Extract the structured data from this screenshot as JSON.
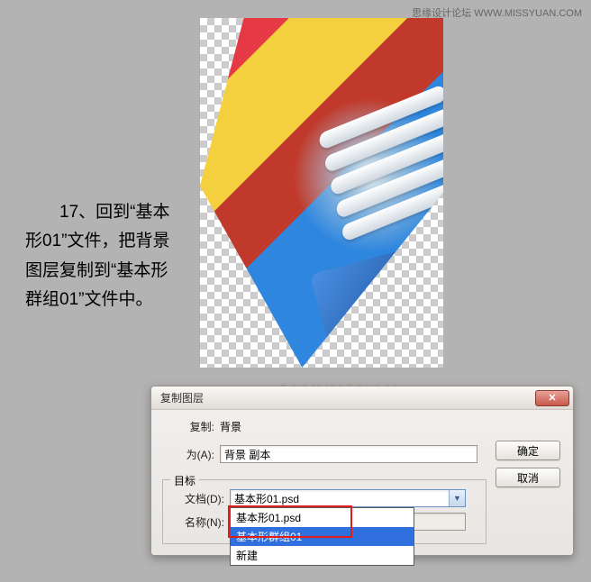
{
  "top_watermark": "思缘设计论坛  WWW.MISSYUAN.COM",
  "instruction": "　　17、回到“基本形01”文件，把背景图层复制到“基本形群组01”文件中。",
  "watermark_brand": "JANNYCHAN",
  "watermark_url": "HTTP://JANNYSTORY.POCO.CN",
  "dialog": {
    "title": "复制图层",
    "copy_label": "复制:",
    "copy_value": "背景",
    "as_label": "为(A):",
    "as_value": "背景 副本",
    "target_legend": "目标",
    "doc_label": "文档(D):",
    "doc_value": "基本形01.psd",
    "name_label": "名称(N):",
    "name_value": "",
    "dropdown": {
      "options": [
        "基本形01.psd",
        "基本形群组01",
        "新建"
      ],
      "selected_index": 1
    },
    "ok": "确定",
    "cancel": "取消"
  }
}
